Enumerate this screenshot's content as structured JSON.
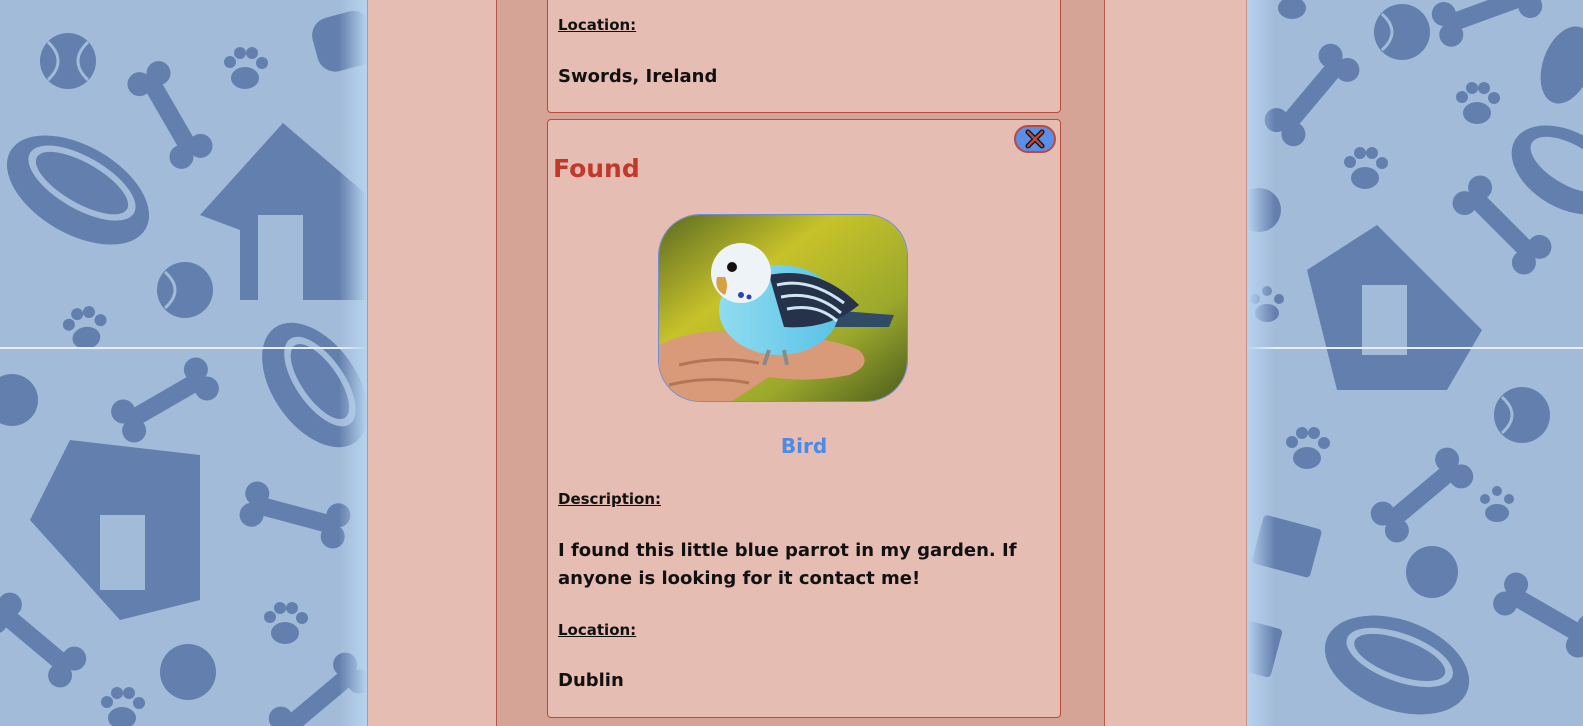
{
  "previous_post": {
    "location_label": "Location:",
    "location_value": "Swords, Ireland"
  },
  "post": {
    "status": "Found",
    "close_icon": "close-x-icon",
    "photo_icon": "parakeet-photo",
    "pet_type": "Bird",
    "description_label": "Description:",
    "description_value": "I found this little blue parrot in my garden. If anyone is looking for it contact me!",
    "location_label": "Location:",
    "location_value": "Dublin"
  },
  "colors": {
    "background_pattern": "#a2bbd8",
    "pattern_shapes": "#637fad",
    "card_background": "#e6bdb3",
    "card_border": "#b84a3e",
    "status_text": "#c0392b",
    "pet_type_text": "#4a8be8",
    "close_button": "#5b8ee6"
  }
}
